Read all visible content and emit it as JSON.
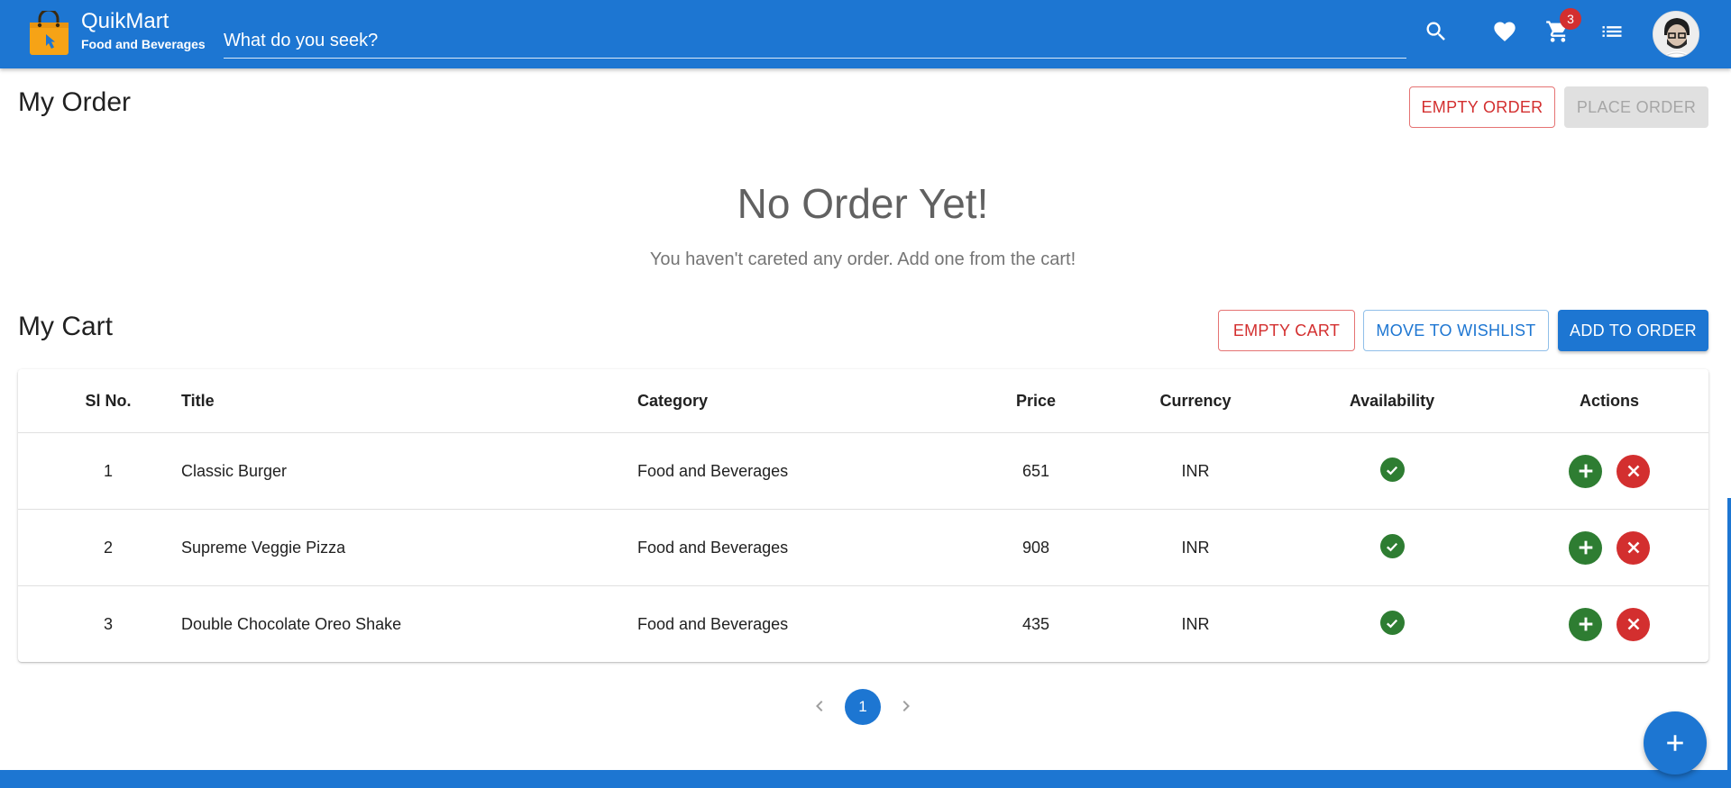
{
  "header": {
    "brand_name": "QuikMart",
    "brand_subtitle": "Food and Beverages",
    "search_placeholder": "What do you seek?",
    "cart_count": "3",
    "icons": [
      "search-icon",
      "heart-icon",
      "cart-icon",
      "list-icon",
      "avatar"
    ]
  },
  "order": {
    "title": "My Order",
    "empty_order_label": "EMPTY ORDER",
    "place_order_label": "PLACE ORDER",
    "empty_title": "No Order Yet!",
    "empty_subtitle": "You haven't careted any order. Add one from the cart!"
  },
  "cart": {
    "title": "My Cart",
    "empty_cart_label": "EMPTY CART",
    "move_to_wishlist_label": "MOVE TO WISHLIST",
    "add_to_order_label": "ADD TO ORDER",
    "columns": [
      "Sl No.",
      "Title",
      "Category",
      "Price",
      "Currency",
      "Availability",
      "Actions"
    ],
    "rows": [
      {
        "sl": "1",
        "title": "Classic Burger",
        "category": "Food and Beverages",
        "price": "651",
        "currency": "INR",
        "available": true
      },
      {
        "sl": "2",
        "title": "Supreme Veggie Pizza",
        "category": "Food and Beverages",
        "price": "908",
        "currency": "INR",
        "available": true
      },
      {
        "sl": "3",
        "title": "Double Chocolate Oreo Shake",
        "category": "Food and Beverages",
        "price": "435",
        "currency": "INR",
        "available": true
      }
    ]
  },
  "pagination": {
    "current_page": "1"
  },
  "colors": {
    "primary": "#1d76d2",
    "danger": "#d32f2f",
    "success": "#2e7d32",
    "disabled": "#e0e0e0"
  }
}
